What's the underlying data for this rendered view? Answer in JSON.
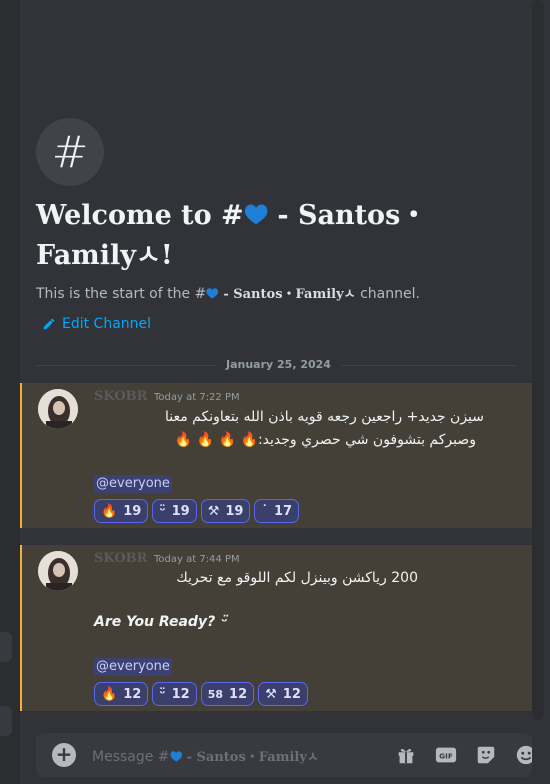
{
  "channel": {
    "name": "- Santos・Familyㅅ",
    "welcome_prefix": "Welcome to #",
    "welcome_suffix": "!",
    "sub_prefix": "This is the start of the #",
    "sub_suffix": "channel.",
    "edit_label": "Edit Channel"
  },
  "date_divider": "January 25, 2024",
  "messages": [
    {
      "author": "SKOBR",
      "time": "Today at 7:22 PM",
      "lines": [
        "سيزن جديد+ راجعين رجعه قويه باذن الله بتعاونكم معنا",
        "وصبركم بتشوفون شي حصري وجديد:🔥 🔥 🔥 🔥"
      ],
      "mention": "@everyone",
      "reactions": [
        {
          "emoji": "🔥",
          "count": "19"
        },
        {
          "emoji": "ᵕ̈",
          "count": "19"
        },
        {
          "emoji": "⚒",
          "count": "19"
        },
        {
          "emoji": "˙",
          "count": "17"
        }
      ]
    },
    {
      "author": "SKOBR",
      "time": "Today at 7:44 PM",
      "lines": [
        "200 رياكشن وبينزل لكم اللوقو مع تحريك",
        "Are You Ready? ᵕ̈"
      ],
      "mention": "@everyone",
      "reactions": [
        {
          "emoji": "🔥",
          "count": "12"
        },
        {
          "emoji": "ᵕ̈",
          "count": "12"
        },
        {
          "emoji": "58",
          "count": "12"
        },
        {
          "emoji": "⚒",
          "count": "12"
        }
      ]
    }
  ],
  "composer": {
    "placeholder_prefix": "Message #",
    "placeholder_channel": "- Santos・Familyㅅ"
  },
  "colors": {
    "background": "#313338",
    "highlight": "#444038",
    "highlight_bar": "#f0b232",
    "link": "#00a8fc",
    "heart": "#1e7fd6"
  },
  "icons": {
    "channel": "hash-icon",
    "edit": "pencil-icon",
    "add": "plus-circle-icon",
    "gift": "gift-icon",
    "gif": "gif-icon",
    "sticker": "sticker-icon",
    "emoji": "emoji-icon"
  }
}
